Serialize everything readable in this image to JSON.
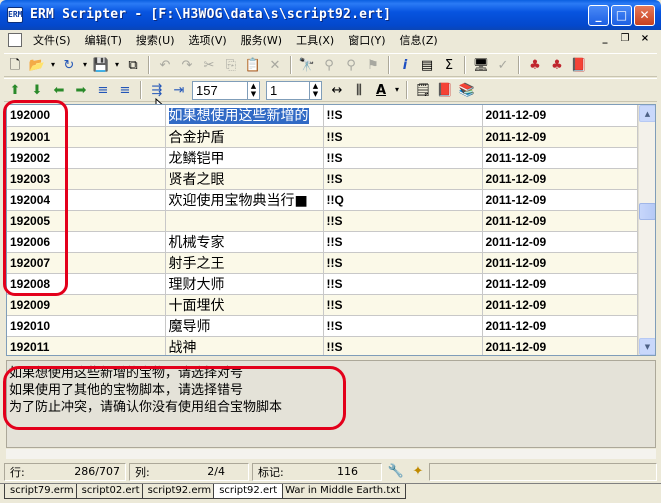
{
  "window": {
    "title": "ERM Scripter - [F:\\H3WOG\\data\\s\\script92.ert]",
    "icon_label": "ERM"
  },
  "menu": [
    "文件(S)",
    "编辑(T)",
    "搜索(U)",
    "选项(V)",
    "服务(W)",
    "工具(X)",
    "窗口(Y)",
    "信息(Z)"
  ],
  "toolbar": {
    "row_input": "157",
    "col_input": "1"
  },
  "rows": [
    {
      "id": "192000",
      "text": "如果想使用这些新增的",
      "cmd": "!!S",
      "date": "2011-12-09",
      "selected": true
    },
    {
      "id": "192001",
      "text": "合金护盾",
      "cmd": "!!S",
      "date": "2011-12-09"
    },
    {
      "id": "192002",
      "text": "龙鳞铠甲",
      "cmd": "!!S",
      "date": "2011-12-09"
    },
    {
      "id": "192003",
      "text": "贤者之眼",
      "cmd": "!!S",
      "date": "2011-12-09"
    },
    {
      "id": "192004",
      "text": "欢迎使用宝物典当行■",
      "cmd": "!!Q",
      "date": "2011-12-09"
    },
    {
      "id": "192005",
      "text": "",
      "cmd": "!!S",
      "date": "2011-12-09"
    },
    {
      "id": "192006",
      "text": "机械专家",
      "cmd": "!!S",
      "date": "2011-12-09"
    },
    {
      "id": "192007",
      "text": "射手之王",
      "cmd": "!!S",
      "date": "2011-12-09"
    },
    {
      "id": "192008",
      "text": "理财大师",
      "cmd": "!!S",
      "date": "2011-12-09"
    },
    {
      "id": "192009",
      "text": "十面埋伏",
      "cmd": "!!S",
      "date": "2011-12-09"
    },
    {
      "id": "192010",
      "text": "魔导师",
      "cmd": "!!S",
      "date": "2011-12-09"
    },
    {
      "id": "192011",
      "text": "战神",
      "cmd": "!!S",
      "date": "2011-12-09"
    }
  ],
  "editor": {
    "lines": [
      "如果想使用这些新增的宝物，请选择对号",
      "如果使用了其他的宝物脚本，请选择错号",
      "为了防止冲突，请确认你没有使用组合宝物脚本"
    ]
  },
  "status": {
    "row_label": "行:",
    "row_value": "286/707",
    "col_label": "列:",
    "col_value": "2/4",
    "mark_label": "标记:",
    "mark_value": "116"
  },
  "tabs": [
    {
      "label": "script79.erm",
      "active": false
    },
    {
      "label": "script02.ert",
      "active": false
    },
    {
      "label": "script92.erm",
      "active": false
    },
    {
      "label": "script92.ert",
      "active": true
    },
    {
      "label": "War in Middle Earth.txt",
      "active": false
    }
  ],
  "colors": {
    "titlebar": "#0754e0",
    "annotation_ring": "#e3001b",
    "selection": "#316ac5"
  }
}
